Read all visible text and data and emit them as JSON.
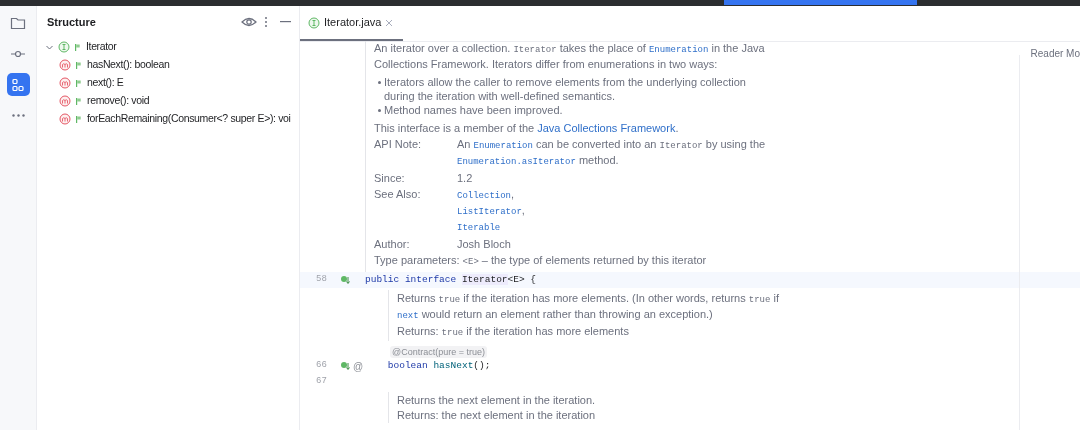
{
  "tool_strip": [
    {
      "kind": "folder",
      "selected": false
    },
    {
      "kind": "commit",
      "selected": false
    },
    {
      "kind": "structure",
      "selected": true
    },
    {
      "kind": "more",
      "selected": false
    }
  ],
  "structure": {
    "title": "Structure",
    "tree": [
      {
        "label": "Iterator",
        "kind": "interface",
        "expanded": true,
        "children": [
          {
            "label": "hasNext(): boolean",
            "kind": "method"
          },
          {
            "label": "next(): E",
            "kind": "method"
          },
          {
            "label": "remove(): void",
            "kind": "method"
          },
          {
            "label": "forEachRemaining(Consumer<? super E>): voi",
            "kind": "method"
          }
        ]
      }
    ]
  },
  "tabs": [
    {
      "label": "Iterator.java",
      "kind": "interface",
      "selected": true
    }
  ],
  "reader_mode": "Reader Mo",
  "editor": [
    {
      "kind": "doc",
      "member": false,
      "blocks": [
        {
          "kind": "paragraph",
          "lines": [
            [
              {
                "text": "An iterator over a collection. ",
                "kind": "text"
              },
              {
                "text": "Iterator",
                "kind": "code"
              },
              {
                "text": " takes the place of ",
                "kind": "text"
              },
              {
                "text": "Enumeration",
                "kind": "code_link"
              },
              {
                "text": " in the Java",
                "kind": "text"
              }
            ],
            [
              {
                "text": "Collections Framework. Iterators differ from enumerations in two ways:",
                "kind": "text"
              }
            ]
          ]
        },
        {
          "kind": "bullets",
          "items": [
            {
              "lines": [
                [
                  {
                    "text": "Iterators allow the caller to remove elements from the underlying collection",
                    "kind": "text"
                  }
                ],
                [
                  {
                    "text": "during the iteration with well-defined semantics.",
                    "kind": "text"
                  }
                ]
              ]
            },
            {
              "lines": [
                [
                  {
                    "text": "Method names have been improved.",
                    "kind": "text"
                  }
                ]
              ]
            }
          ]
        },
        {
          "kind": "paragraph",
          "lines": [
            [
              {
                "text": "This interface is a member of the ",
                "kind": "text"
              },
              {
                "text": "Java Collections Framework",
                "kind": "link"
              },
              {
                "text": ".",
                "kind": "text"
              }
            ]
          ]
        },
        {
          "kind": "tags",
          "rows": [
            {
              "label": "API Note:",
              "lines": [
                [
                  {
                    "text": "An ",
                    "kind": "text"
                  },
                  {
                    "text": "Enumeration",
                    "kind": "code_link"
                  },
                  {
                    "text": " can be converted into an ",
                    "kind": "text"
                  },
                  {
                    "text": "Iterator",
                    "kind": "code"
                  },
                  {
                    "text": " by using the",
                    "kind": "text"
                  }
                ],
                [
                  {
                    "text": "Enumeration.asIterator",
                    "kind": "code_link"
                  },
                  {
                    "text": " method.",
                    "kind": "text"
                  }
                ]
              ]
            },
            {
              "label": "Since:",
              "lines": [
                [
                  {
                    "text": "1.2",
                    "kind": "text"
                  }
                ]
              ]
            },
            {
              "label": "See Also:",
              "lines": [
                [
                  {
                    "text": "Collection",
                    "kind": "code_link"
                  },
                  {
                    "text": ",",
                    "kind": "text"
                  }
                ],
                [
                  {
                    "text": "ListIterator",
                    "kind": "code_link"
                  },
                  {
                    "text": ",",
                    "kind": "text"
                  }
                ],
                [
                  {
                    "text": "Iterable",
                    "kind": "code_link"
                  }
                ]
              ]
            },
            {
              "label": "Author:",
              "lines": [
                [
                  {
                    "text": "Josh Bloch",
                    "kind": "text"
                  }
                ]
              ]
            },
            {
              "label": "Type parameters:",
              "lines": [
                [
                  {
                    "text": "<E>",
                    "kind": "code"
                  },
                  {
                    "text": " – the type of elements returned by this iterator",
                    "kind": "text"
                  }
                ]
              ]
            }
          ]
        }
      ]
    },
    {
      "kind": "code",
      "number": "58",
      "current": true,
      "implemented": true,
      "tokens": [
        {
          "text": "public interface ",
          "kind": "keyword"
        },
        {
          "text": "Iterator",
          "kind": "highlighted"
        },
        {
          "text": "<E> {",
          "kind": "plain"
        }
      ]
    },
    {
      "kind": "doc",
      "member": true,
      "blocks": [
        {
          "kind": "paragraph",
          "lines": [
            [
              {
                "text": "Returns ",
                "kind": "text"
              },
              {
                "text": "true",
                "kind": "code"
              },
              {
                "text": " if the iteration has more elements. (In other words, returns ",
                "kind": "text"
              },
              {
                "text": "true",
                "kind": "code"
              },
              {
                "text": " if",
                "kind": "text"
              }
            ],
            [
              {
                "text": "next",
                "kind": "code_link"
              },
              {
                "text": " would return an element rather than throwing an exception.)",
                "kind": "text"
              }
            ]
          ]
        },
        {
          "kind": "returns",
          "label": "Returns:",
          "lines": [
            [
              {
                "text": "true",
                "kind": "code"
              },
              {
                "text": " if the iteration has more elements",
                "kind": "text"
              }
            ]
          ]
        }
      ]
    },
    {
      "kind": "hint",
      "text": "@Contract(pure = true)"
    },
    {
      "kind": "code",
      "number": "66",
      "current": false,
      "gutter_mark": "@",
      "implemented": true,
      "tokens": [
        {
          "text": "    boolean ",
          "kind": "keyword"
        },
        {
          "text": "hasNext",
          "kind": "declaration"
        },
        {
          "text": "();",
          "kind": "plain"
        }
      ]
    },
    {
      "kind": "code",
      "number": "67",
      "current": false,
      "implemented": false
    },
    {
      "kind": "doc",
      "member": true,
      "blocks": [
        {
          "kind": "paragraph",
          "lines": [
            [
              {
                "text": "Returns the next element in the iteration.",
                "kind": "text"
              }
            ]
          ]
        },
        {
          "kind": "returns",
          "label": "Returns:",
          "lines": [
            [
              {
                "text": "the next element in the iteration",
                "kind": "text"
              }
            ]
          ]
        }
      ]
    }
  ]
}
